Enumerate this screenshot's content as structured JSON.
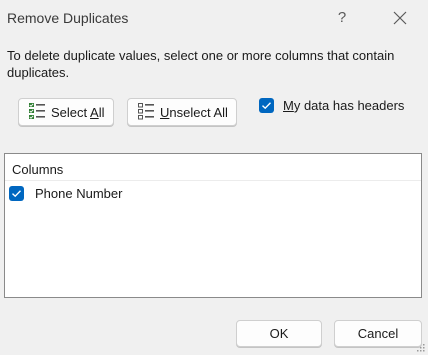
{
  "window": {
    "title": "Remove Duplicates",
    "help_glyph": "?"
  },
  "instructions": "To delete duplicate values, select one or more columns that contain duplicates.",
  "buttons": {
    "select_all": {
      "pre": "Select ",
      "underlined": "A",
      "post": "ll",
      "icon": "select-all-icon"
    },
    "unselect_all": {
      "pre": "",
      "underlined": "U",
      "post": "nselect All",
      "icon": "unselect-all-icon"
    }
  },
  "headers_option": {
    "underlined": "M",
    "label_rest": "y data has headers",
    "checked": true
  },
  "columns": {
    "header": "Columns",
    "items": [
      {
        "label": "Phone Number",
        "checked": true
      }
    ]
  },
  "footer": {
    "ok": "OK",
    "cancel": "Cancel"
  },
  "colors": {
    "accent": "#0067c0",
    "background": "#f0f0f0"
  }
}
